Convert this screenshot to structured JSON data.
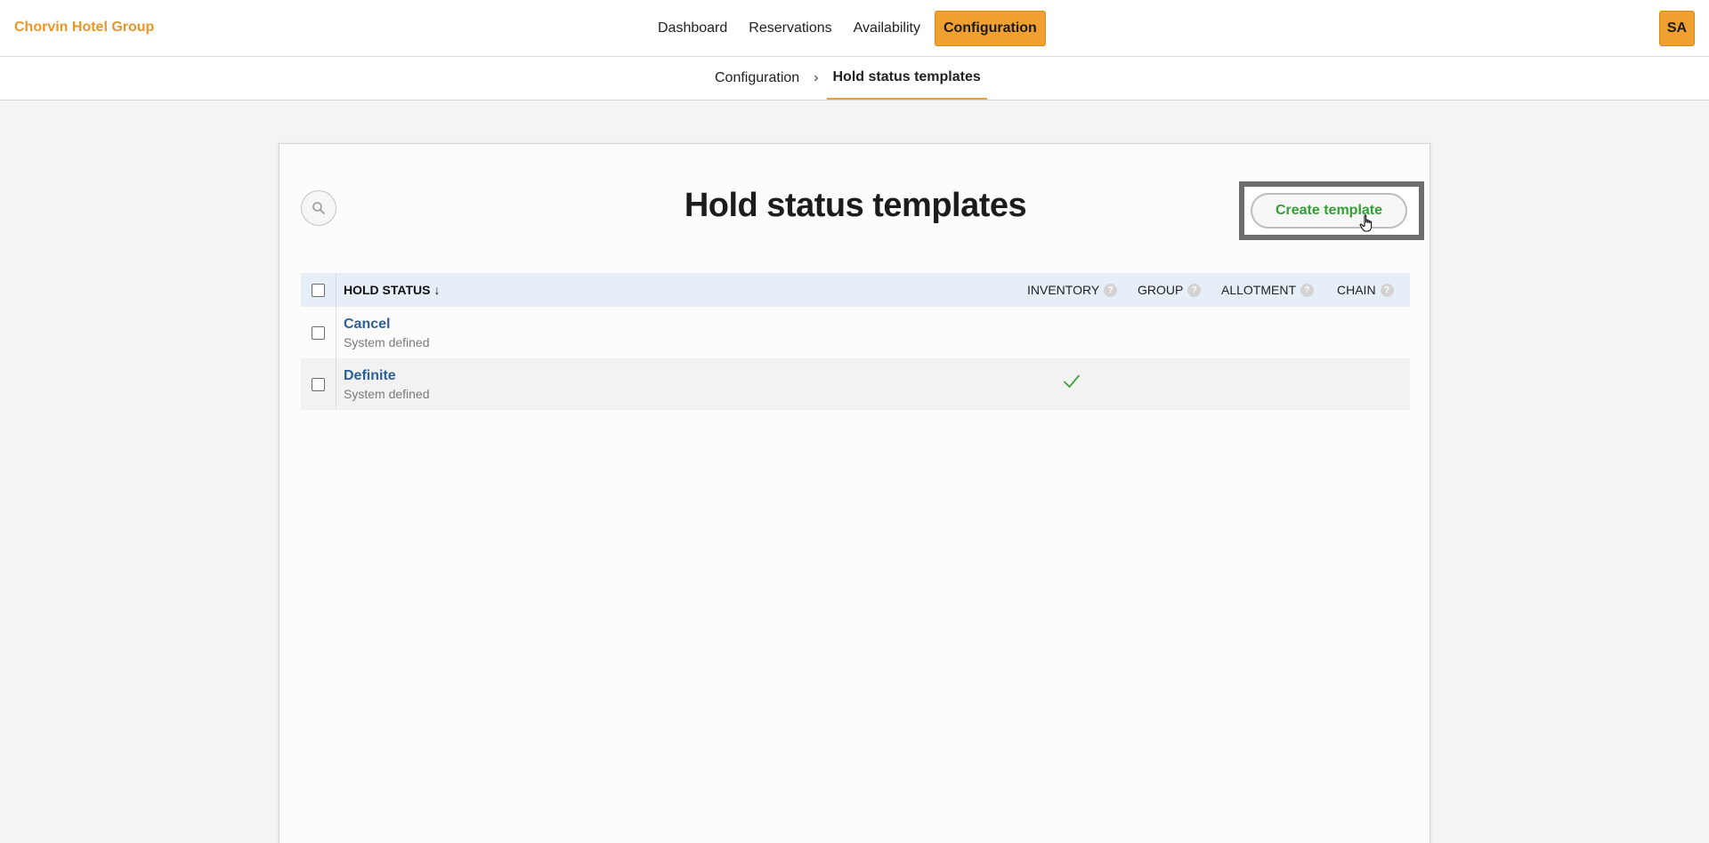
{
  "header": {
    "brand": "Chorvin Hotel Group",
    "nav": [
      {
        "label": "Dashboard",
        "active": false
      },
      {
        "label": "Reservations",
        "active": false
      },
      {
        "label": "Availability",
        "active": false
      },
      {
        "label": "Configuration",
        "active": true
      }
    ],
    "avatar_initials": "SA"
  },
  "breadcrumb": {
    "parent": "Configuration",
    "separator": "›",
    "current": "Hold status templates"
  },
  "page": {
    "title": "Hold status templates",
    "search_icon": "search-icon",
    "create_button_label": "Create template"
  },
  "table": {
    "columns": {
      "status": "HOLD STATUS",
      "sort_indicator": "↓",
      "inventory": "INVENTORY",
      "group": "GROUP",
      "allotment": "ALLOTMENT",
      "chain": "CHAIN",
      "help_glyph": "?"
    },
    "rows": [
      {
        "name": "Cancel",
        "subtitle": "System defined",
        "inventory": false,
        "group": false,
        "allotment": false,
        "chain": false
      },
      {
        "name": "Definite",
        "subtitle": "System defined",
        "inventory": true,
        "group": false,
        "allotment": false,
        "chain": false
      }
    ]
  },
  "colors": {
    "accent": "#f0a030",
    "brand_text": "#e8962a",
    "link": "#2d5f98",
    "create_text": "#33a033",
    "check": "#3aa33a"
  }
}
